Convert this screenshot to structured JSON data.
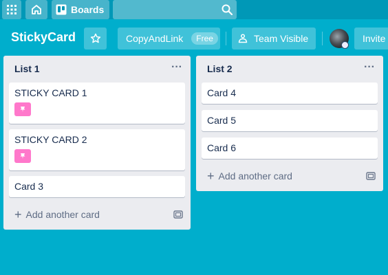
{
  "topbar": {
    "apps_icon": "apps-grid-icon",
    "home_icon": "home-icon",
    "boards_icon": "trello-boards-icon",
    "boards_label": "Boards",
    "search_icon": "search-icon"
  },
  "board": {
    "title": "StickyCard",
    "star_icon": "star-icon",
    "org_name": "CopyAndLink",
    "org_badge": "Free",
    "visibility_icon": "team-visibility-icon",
    "visibility_label": "Team Visible",
    "invite_label": "Invite"
  },
  "lists": [
    {
      "title": "List 1",
      "menu": "···",
      "cards": [
        {
          "title": "STICKY CARD 1",
          "label_color": "#ff78cb"
        },
        {
          "title": "STICKY CARD 2",
          "label_color": "#ff78cb"
        },
        {
          "title": "Card 3"
        }
      ],
      "add_label": "Add another card"
    },
    {
      "title": "List 2",
      "menu": "···",
      "cards": [
        {
          "title": "Card 4"
        },
        {
          "title": "Card 5"
        },
        {
          "title": "Card 6"
        }
      ],
      "add_label": "Add another card"
    }
  ],
  "colors": {
    "background": "#00aecc",
    "list_bg": "#ebecf0",
    "label_pink": "#ff78cb"
  }
}
